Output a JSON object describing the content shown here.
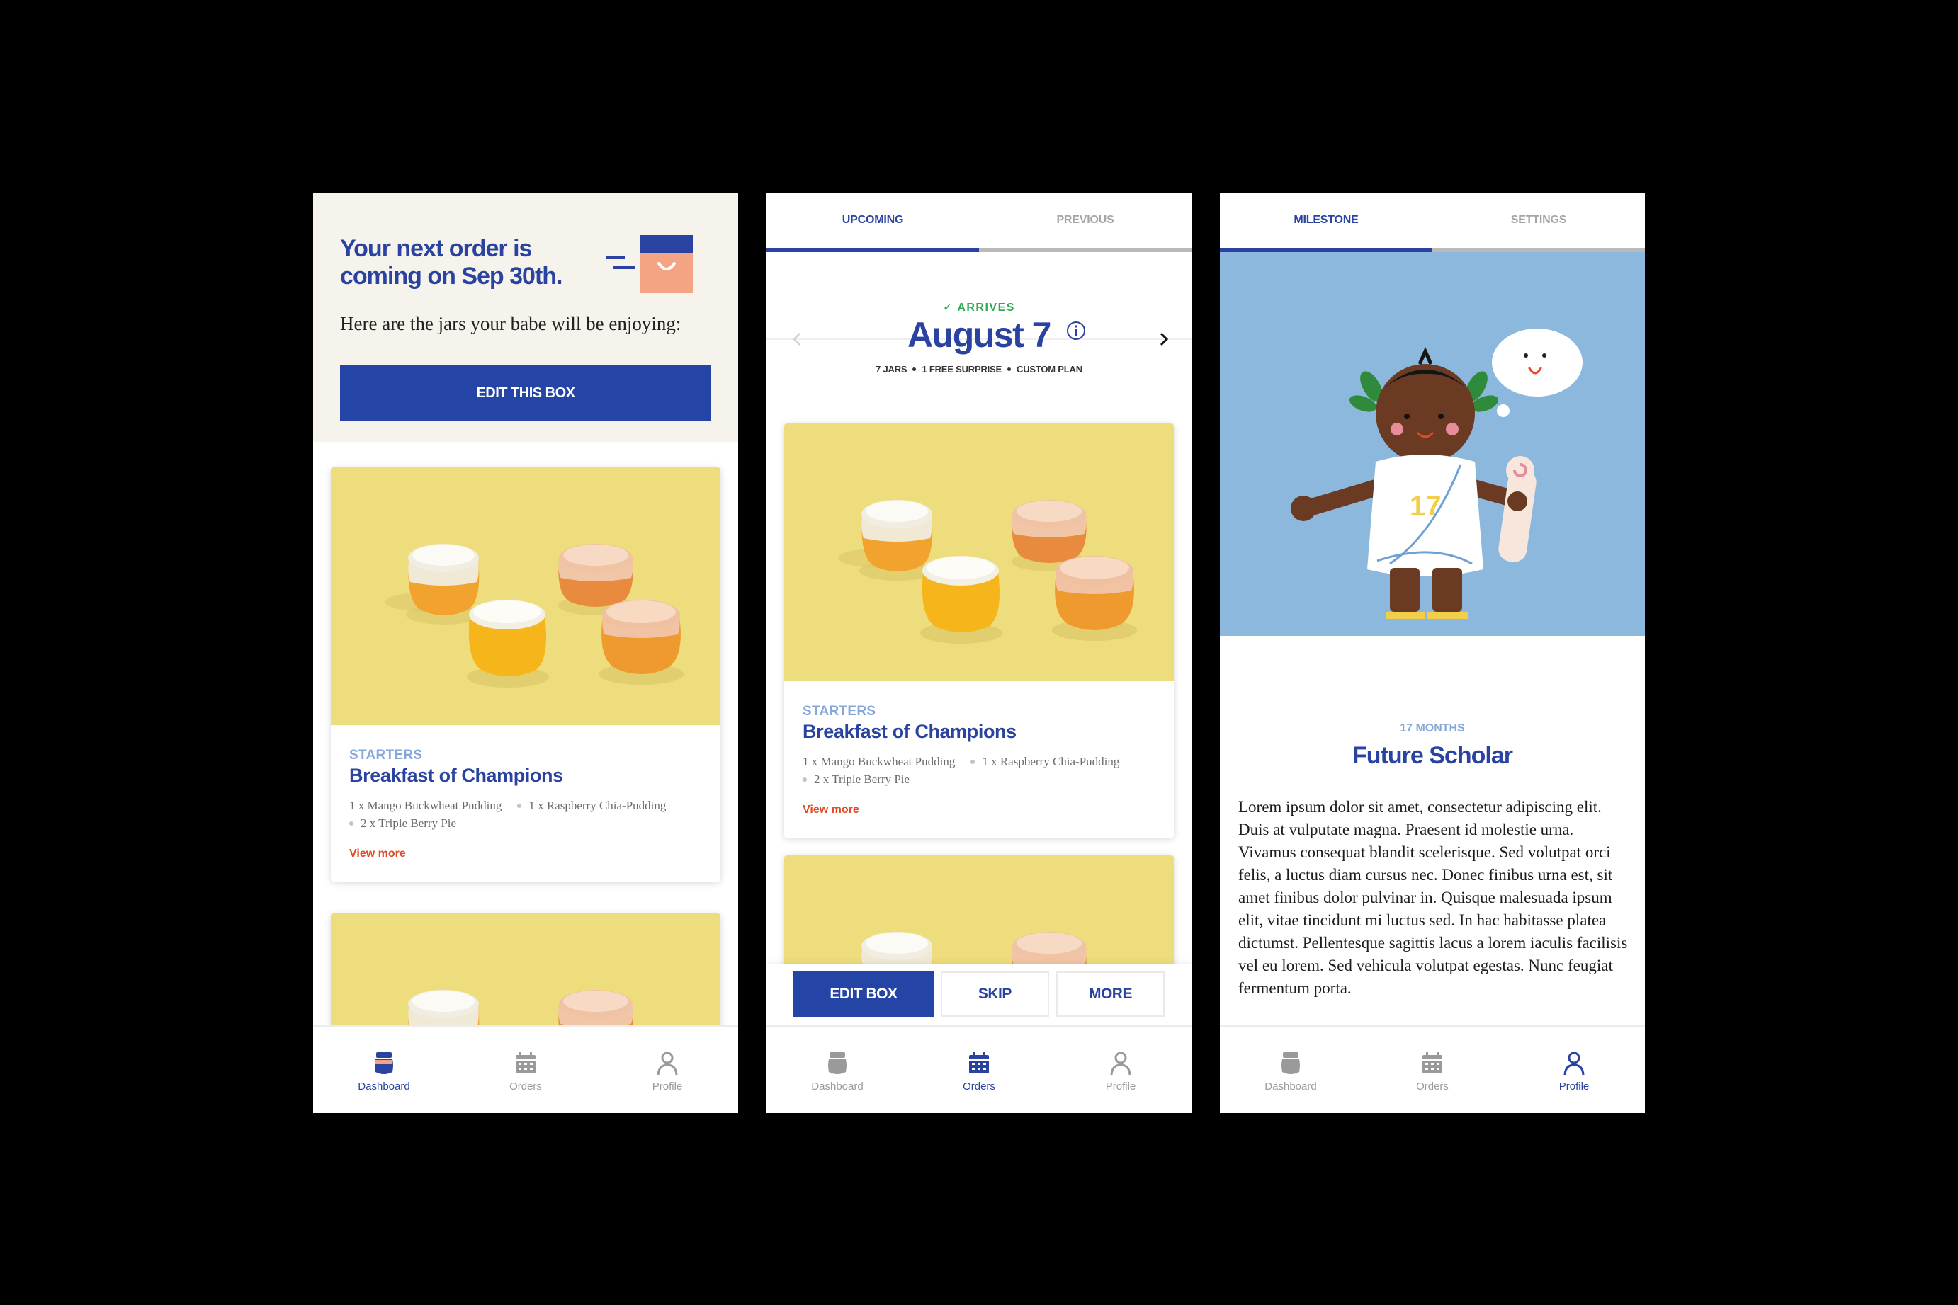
{
  "colors": {
    "brand_navy": "#2a43a1",
    "button_blue": "#2445a5",
    "accent_orange": "#e14a24",
    "arrives_green": "#35a856",
    "category_blue": "#85a8d9"
  },
  "nav": {
    "dashboard": "Dashboard",
    "orders": "Orders",
    "profile": "Profile"
  },
  "dashboard": {
    "title_line1": "Your next order is",
    "title_line2": "coming on Sep 30th.",
    "subtitle": "Here are the jars your babe will be enjoying:",
    "edit_button": "EDIT THIS BOX",
    "card": {
      "category": "STARTERS",
      "title": "Breakfast of Champions",
      "ingredients": [
        "1 x Mango Buckwheat Pudding",
        "1 x Raspberry Chia-Pudding",
        "2 x Triple Berry Pie"
      ],
      "view_more": "View more"
    }
  },
  "orders": {
    "tabs": [
      "UPCOMING",
      "PREVIOUS"
    ],
    "arrives_label": "ARRIVES",
    "date": "August 7",
    "plan": [
      "7 JARS",
      "1 FREE SURPRISE",
      "CUSTOM PLAN"
    ],
    "card": {
      "category": "STARTERS",
      "title": "Breakfast of Champions",
      "ingredients": [
        "1 x Mango Buckwheat Pudding",
        "1 x Raspberry Chia-Pudding",
        "2 x Triple Berry Pie"
      ],
      "view_more": "View more"
    },
    "actions": {
      "edit": "EDIT BOX",
      "skip": "SKIP",
      "more": "MORE"
    }
  },
  "profile": {
    "tabs": [
      "MILESTONE",
      "SETTINGS"
    ],
    "shirt_number": "17",
    "age": "17 MONTHS",
    "title": "Future Scholar",
    "body": "Lorem ipsum dolor sit amet, consectetur adipiscing elit. Duis at vulputate magna. Praesent id molestie urna. Vivamus consequat blandit scelerisque. Sed volutpat orci felis, a luctus diam cursus nec. Donec finibus urna est, sit amet finibus dolor pulvinar in. Quisque malesuada ipsum elit, vitae tincidunt mi luctus sed. In hac habitasse platea dictumst. Pellentesque sagittis lacus a lorem iaculis facilisis vel eu lorem. Sed vehicula volutpat egestas. Nunc feugiat fermentum porta."
  }
}
